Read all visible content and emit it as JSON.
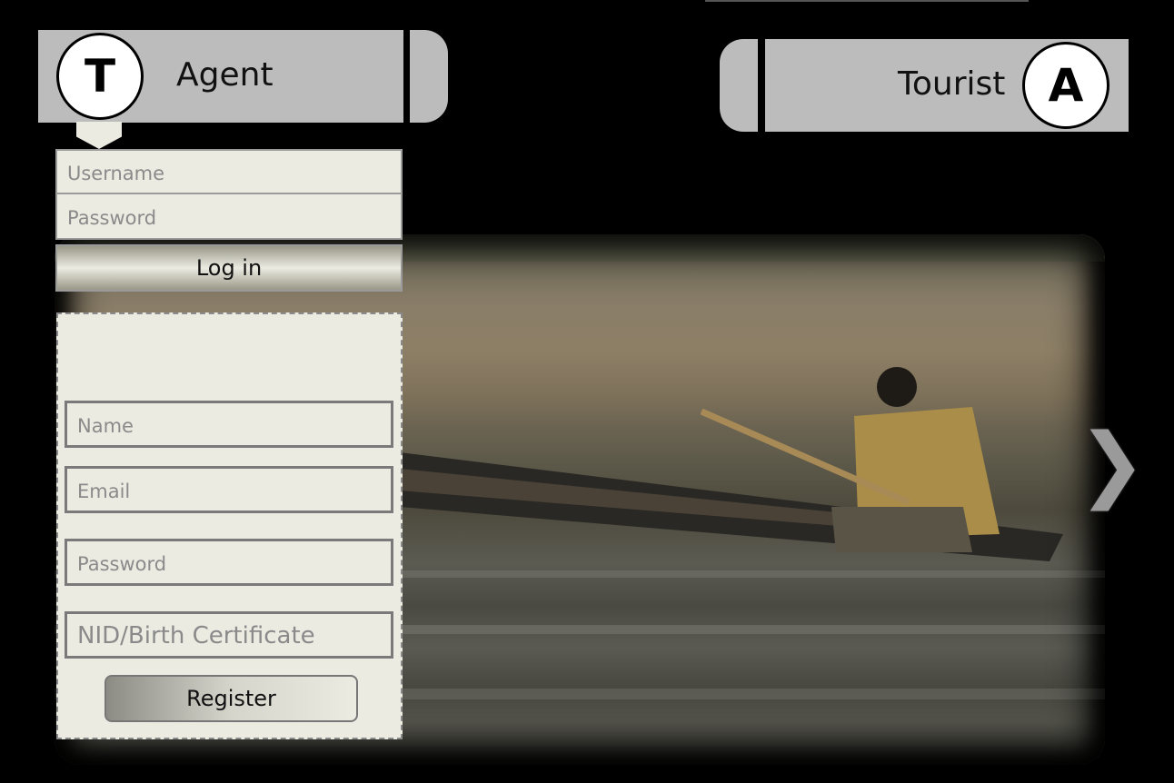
{
  "agent_tab": {
    "badge_letter": "T",
    "label": "Agent"
  },
  "tourist_tab": {
    "badge_letter": "A",
    "label": "Tourist"
  },
  "login": {
    "username_placeholder": "Username",
    "password_placeholder": "Password",
    "button_label": "Log in"
  },
  "register": {
    "name_placeholder": "Name",
    "email_placeholder": "Email",
    "password_placeholder": "Password",
    "nid_placeholder": "NID/Birth Certificate",
    "button_label": "Register"
  },
  "carousel": {
    "next_glyph": "❯"
  },
  "colors": {
    "background": "#000000",
    "tab": "#bcbcbc",
    "form_bg": "#ecebe2"
  }
}
